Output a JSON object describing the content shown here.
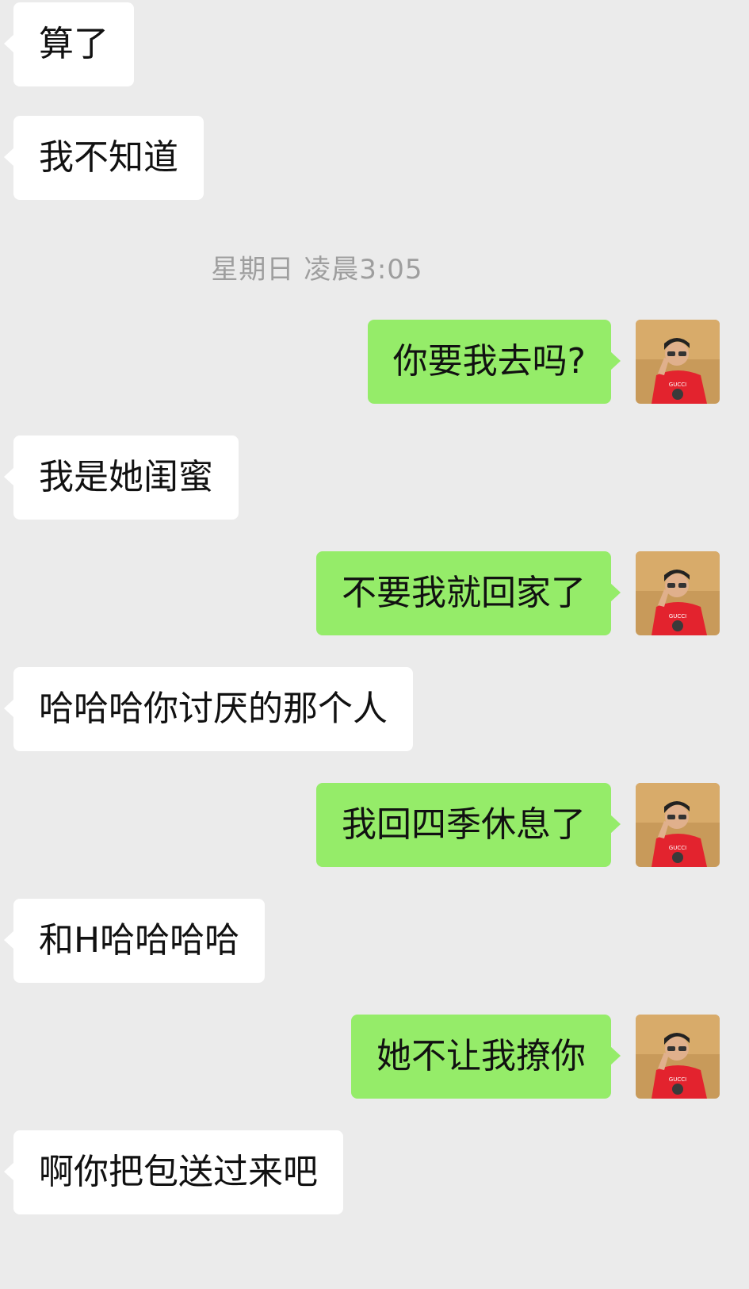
{
  "chat": {
    "messages": [
      {
        "side": "in",
        "text": "算了"
      },
      {
        "side": "in",
        "text": "我不知道"
      },
      {
        "side": "out",
        "text": "你要我去吗?",
        "avatar": "user-avatar"
      },
      {
        "side": "in",
        "text": "我是她闺蜜"
      },
      {
        "side": "out",
        "text": "不要我就回家了",
        "avatar": "user-avatar"
      },
      {
        "side": "in",
        "text": "哈哈哈你讨厌的那个人"
      },
      {
        "side": "out",
        "text": "我回四季休息了",
        "avatar": "user-avatar"
      },
      {
        "side": "in",
        "text": "和H哈哈哈哈"
      },
      {
        "side": "out",
        "text": "她不让我撩你",
        "avatar": "user-avatar"
      },
      {
        "side": "in",
        "text": "啊你把包送过来吧"
      }
    ],
    "timestamp": "星期日 凌晨3:05"
  },
  "colors": {
    "background": "#ebebeb",
    "incoming_bubble": "#ffffff",
    "outgoing_bubble": "#95ec69",
    "timestamp_text": "#9e9e9e"
  }
}
